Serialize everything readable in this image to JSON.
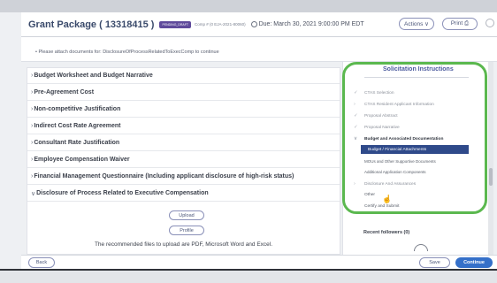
{
  "header": {
    "title": "Grant Package ( 13318415 )",
    "badge": "PENDING_DRAFT",
    "comp": "Comp # (0 EJA-2021-80060)",
    "due": "Due: March 30, 2021 9:00:00 PM EDT",
    "actions_label": "Actions ∨",
    "print_label": "Print ⎙"
  },
  "notice": "•  Please attach documents for: DisclosureOfProcessRelatedToExecComp to continue",
  "sections": [
    {
      "label": "Budget Worksheet and Budget Narrative",
      "chevron": "›"
    },
    {
      "label": "Pre-Agreement Cost",
      "chevron": "›"
    },
    {
      "label": "Non-competitive Justification",
      "chevron": "›"
    },
    {
      "label": "Indirect Cost Rate Agreement",
      "chevron": "›"
    },
    {
      "label": "Consultant Rate Justification",
      "chevron": "›"
    },
    {
      "label": "Employee Compensation Waiver",
      "chevron": "›"
    },
    {
      "label": "Financial Management Questionnaire (Including applicant disclosure of high-risk status)",
      "chevron": "›"
    },
    {
      "label": "Disclosure of Process Related to Executive Compensation",
      "chevron": "∨"
    }
  ],
  "expanded": {
    "upload_label": "Upload",
    "profile_label": "Profile",
    "note": "The recommended files to upload are PDF, Microsoft Word and Excel."
  },
  "solicitation": {
    "title": "Solicitation Instructions",
    "items": [
      {
        "label": "CTAS Selection",
        "mark": "✓"
      },
      {
        "label": "CTAS Resident Applicant Information",
        "mark": "›"
      },
      {
        "label": "Proposal Abstract",
        "mark": "✓"
      },
      {
        "label": "Proposal Narrative",
        "mark": "✓"
      },
      {
        "label": "Budget and Associated Documentation",
        "mark": "∨"
      }
    ],
    "active_sub": "Budget / Financial Attachments",
    "subitems": [
      "MOUs and Other Supportive Documents",
      "Additional Application Components"
    ],
    "after_items": [
      {
        "label": "Disclosure And Assurances",
        "mark": "›"
      },
      {
        "label": "Other",
        "mark": ""
      },
      {
        "label": "Certify and Submit",
        "mark": ""
      }
    ],
    "followers": "Recent followers (0)"
  },
  "footer": {
    "back_label": "Back",
    "save_label": "Save",
    "continue_label": "Continue"
  }
}
